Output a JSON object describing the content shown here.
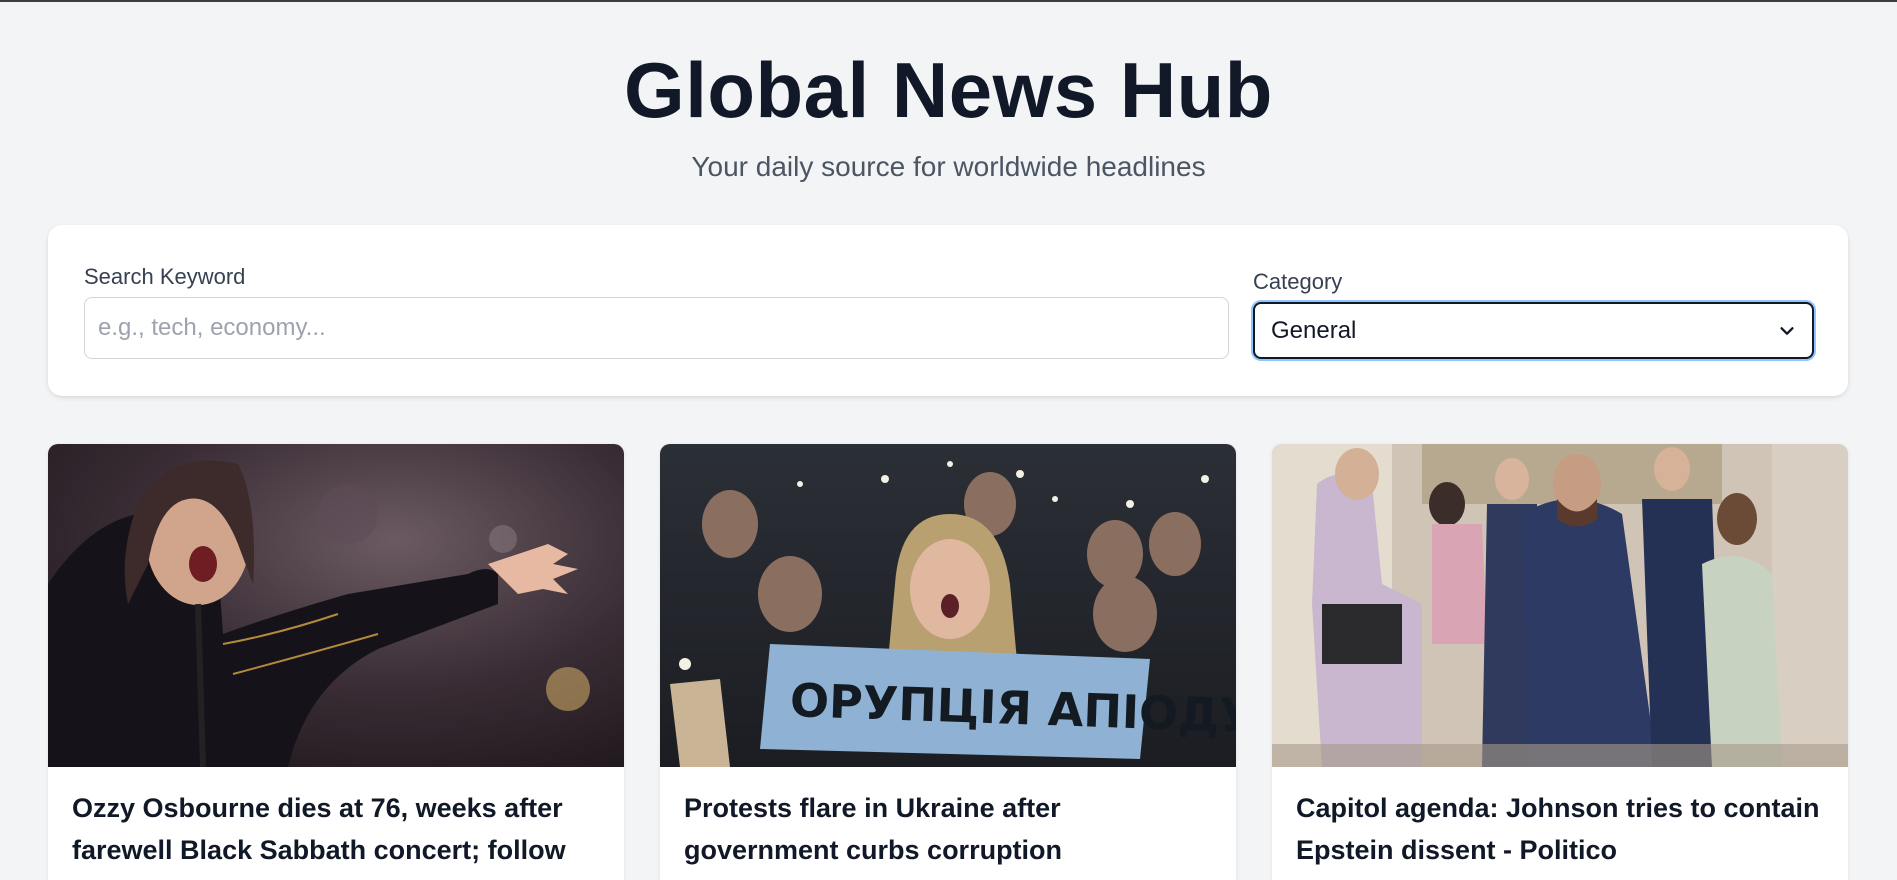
{
  "header": {
    "title": "Global News Hub",
    "subtitle": "Your daily source for worldwide headlines"
  },
  "search": {
    "keyword_label": "Search Keyword",
    "keyword_placeholder": "e.g., tech, economy...",
    "keyword_value": "",
    "category_label": "Category",
    "category_value": "General"
  },
  "articles": [
    {
      "title": "Ozzy Osbourne dies at 76, weeks after farewell Black Sabbath concert; follow",
      "image": "concert-singer-photo"
    },
    {
      "title": "Protests flare in Ukraine after government curbs corruption",
      "image": "protest-crowd-photo",
      "sign_text": "ОРУПЦІЯ АПІОДУЄ"
    },
    {
      "title": "Capitol agenda: Johnson tries to contain Epstein dissent - Politico",
      "image": "capitol-hallway-photo"
    }
  ]
}
